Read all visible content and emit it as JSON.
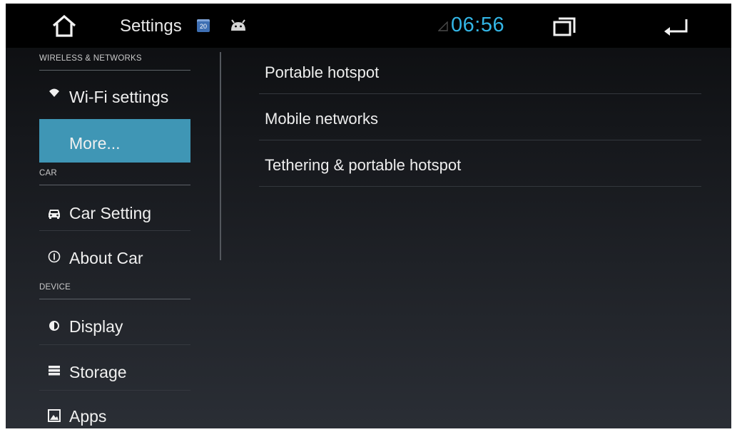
{
  "status_bar": {
    "title": "Settings",
    "calendar_badge": "20",
    "clock": "06:56",
    "icons": [
      "home-icon",
      "calendar-icon",
      "android-debug-icon",
      "signal-icon",
      "recent-apps-icon",
      "back-icon"
    ],
    "accent_color": "#33b5e5"
  },
  "sidebar": {
    "sections": [
      {
        "header": "WIRELESS & NETWORKS"
      },
      {
        "header": "CAR"
      },
      {
        "header": "DEVICE"
      }
    ],
    "items": [
      {
        "label": "Wi-Fi settings",
        "icon": "wifi-icon"
      },
      {
        "label": "More...",
        "icon": "",
        "selected": true
      },
      {
        "label": "Car Setting",
        "icon": "car-icon"
      },
      {
        "label": "About Car",
        "icon": "info-icon"
      },
      {
        "label": "Display",
        "icon": "brightness-icon"
      },
      {
        "label": "Storage",
        "icon": "storage-icon"
      },
      {
        "label": "Apps",
        "icon": "apps-icon"
      }
    ],
    "selected_color": "#3f96b5"
  },
  "content": {
    "items": [
      {
        "label": "Portable hotspot"
      },
      {
        "label": "Mobile networks"
      },
      {
        "label": "Tethering & portable hotspot"
      }
    ]
  }
}
